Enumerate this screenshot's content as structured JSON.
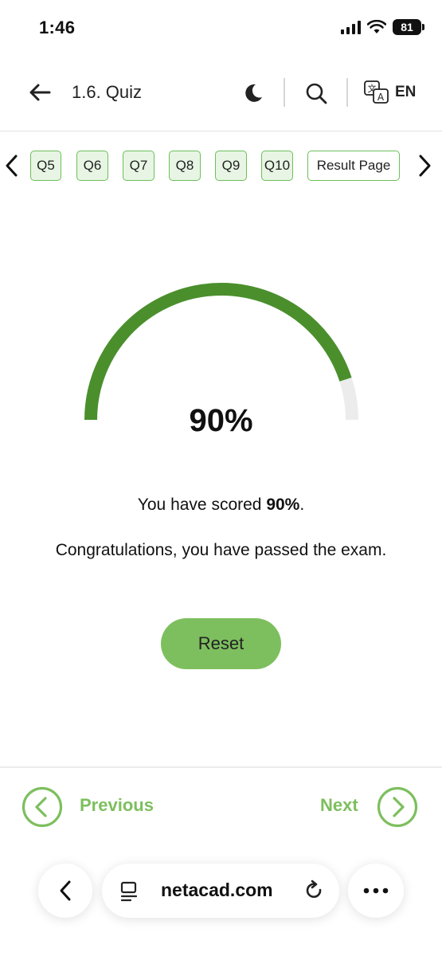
{
  "status_bar": {
    "time": "1:46",
    "battery": "81"
  },
  "header": {
    "title": "1.6. Quiz",
    "language": "EN"
  },
  "question_nav": {
    "items": [
      "Q5",
      "Q6",
      "Q7",
      "Q8",
      "Q9",
      "Q10"
    ],
    "result_label": "Result Page"
  },
  "result": {
    "score_percent": 90,
    "score_display": "90%",
    "score_prefix": "You have scored ",
    "score_value": "90%",
    "score_suffix": ".",
    "message": "Congratulations, you have passed the exam.",
    "reset_label": "Reset"
  },
  "footer": {
    "previous_label": "Previous",
    "next_label": "Next"
  },
  "browser": {
    "url": "netacad.com"
  },
  "colors": {
    "accent_green": "#7dbf5e",
    "gauge_fill": "#4a8f2c",
    "gauge_track": "#ececec",
    "qbtn_border": "#6cbf5a",
    "qbtn_bg": "#e8f5e4"
  }
}
